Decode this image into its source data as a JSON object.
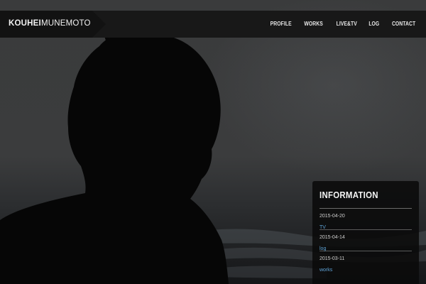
{
  "site": {
    "logo_bold": "KOUHEI",
    "logo_light": "MUNEMOTO"
  },
  "nav": {
    "items": [
      {
        "label": "PROFILE"
      },
      {
        "label": "WORKS"
      },
      {
        "label": "LIVE&TV"
      },
      {
        "label": "LOG"
      },
      {
        "label": "CONTACT"
      }
    ]
  },
  "information": {
    "title": "INFORMATION",
    "items": [
      {
        "date": "2015-04-20",
        "category": "TV"
      },
      {
        "date": "2015-04-14",
        "category": "log"
      },
      {
        "date": "2015-03-11",
        "category": "works"
      }
    ]
  },
  "colors": {
    "header_bg": "#181818",
    "panel_bg": "#0a0a0a",
    "link_accent": "#5fa3d6"
  }
}
